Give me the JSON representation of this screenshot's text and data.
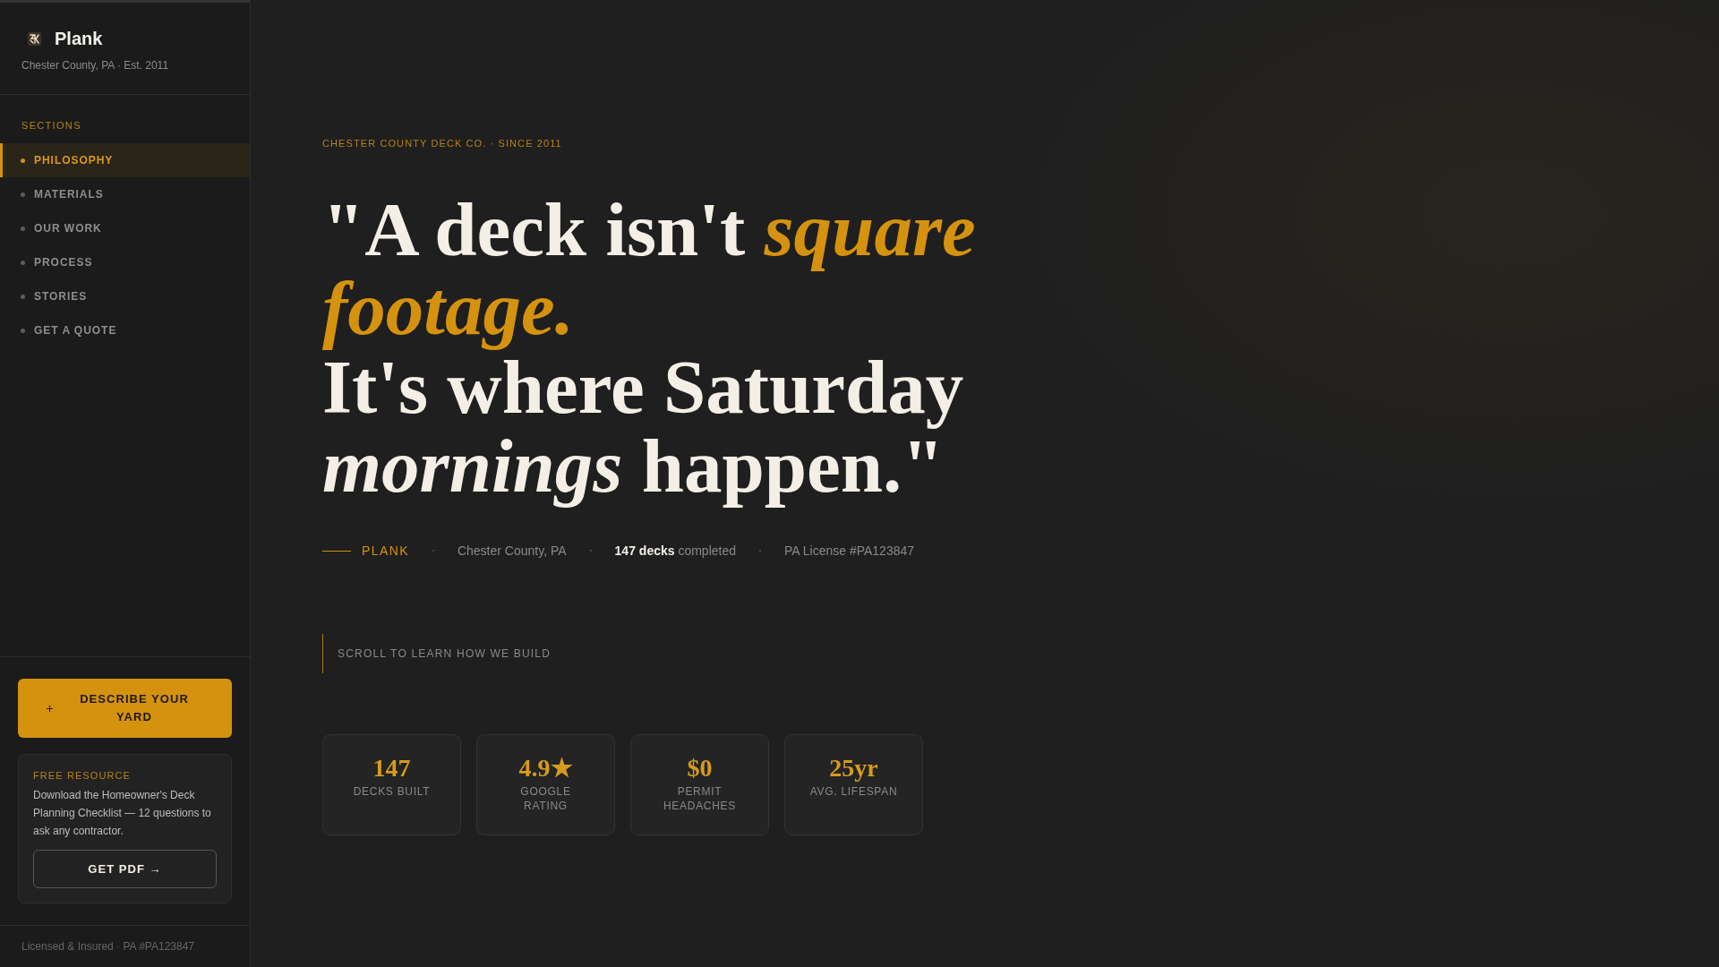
{
  "sidebar": {
    "brand": {
      "name": "Plank",
      "tagline": "Chester County, PA · Est. 2011"
    },
    "nav": {
      "heading": "SECTIONS",
      "items": [
        {
          "label": "PHILOSOPHY",
          "selected": true
        },
        {
          "label": "MATERIALS",
          "selected": false
        },
        {
          "label": "OUR WORK",
          "selected": false
        },
        {
          "label": "PROCESS",
          "selected": false
        },
        {
          "label": "STORIES",
          "selected": false
        },
        {
          "label": "GET A QUOTE",
          "selected": false
        }
      ]
    },
    "cta_button": "DESCRIBE YOUR YARD",
    "resource_card": {
      "eyebrow": "FREE RESOURCE",
      "text": "Download the Homeowner's Deck Planning Checklist — 12 questions to ask any contractor.",
      "button": "GET PDF →"
    },
    "footer": "Licensed & Insured · PA #PA123847"
  },
  "hero": {
    "eyebrow": "CHESTER COUNTY DECK CO. · SINCE 2011",
    "headline": [
      [
        {
          "kind": "plain",
          "text": "\"A deck isn't "
        },
        {
          "kind": "accent",
          "text": "square"
        }
      ],
      [
        {
          "kind": "accent",
          "text": "footage."
        }
      ],
      [
        {
          "kind": "plain",
          "text": "It's where Saturday"
        }
      ],
      [
        {
          "kind": "italic",
          "text": "mornings"
        },
        {
          "kind": "plain",
          "text": " happen.\""
        }
      ]
    ],
    "byline": {
      "brand": "PLANK",
      "facts": [
        "Chester County, PA",
        "**147 decks** completed",
        "PA License #PA123847"
      ]
    },
    "scroll_hint": "SCROLL TO LEARN HOW WE BUILD",
    "stats": [
      {
        "value": "147",
        "label": "DECKS BUILT"
      },
      {
        "value": "4.9★",
        "label": "GOOGLE RATING"
      },
      {
        "value": "$0",
        "label": "PERMIT HEADACHES"
      },
      {
        "value": "25yr",
        "label": "AVG. LIFESPAN"
      }
    ]
  }
}
